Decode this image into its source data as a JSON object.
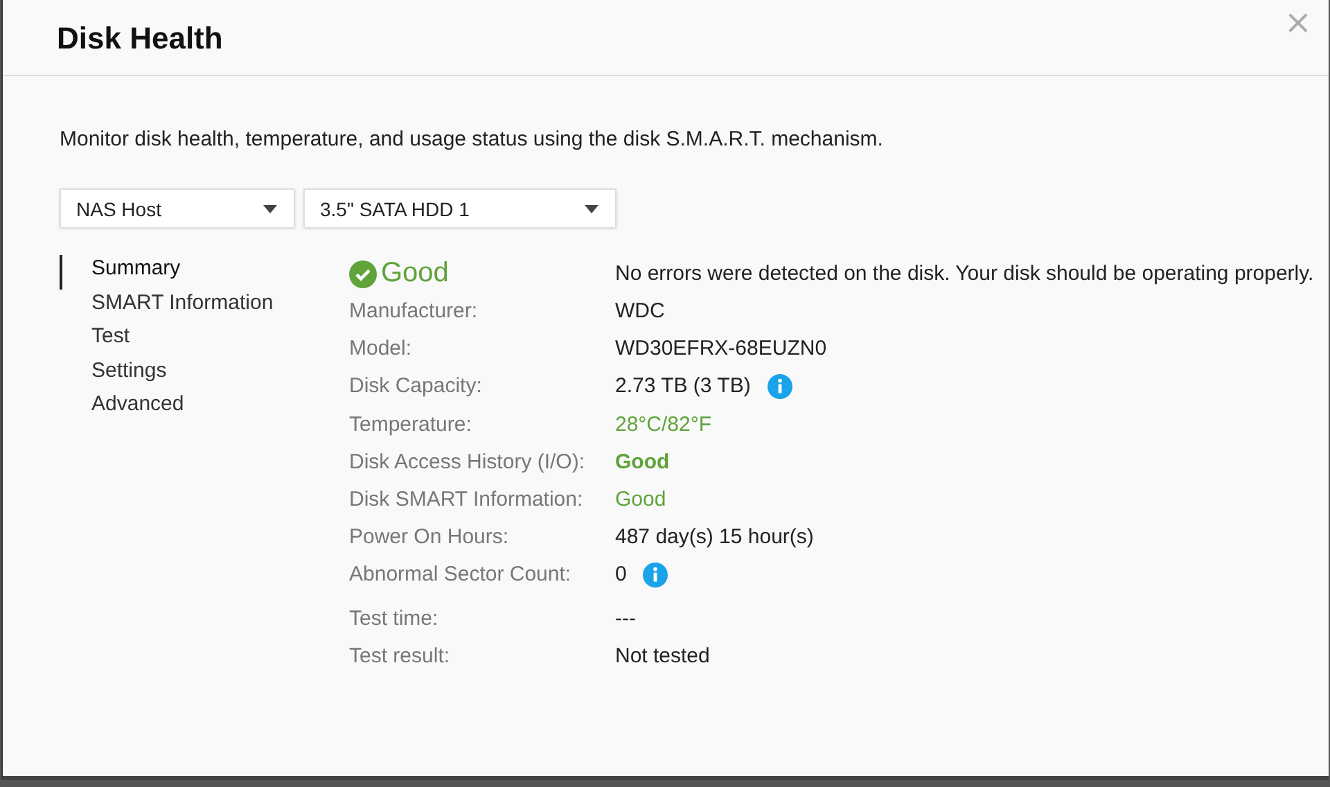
{
  "window": {
    "title": "Disk Health",
    "close": "×"
  },
  "description": "Monitor disk health, temperature, and usage status using the disk S.M.A.R.T. mechanism.",
  "selectors": [
    {
      "value": "NAS Host"
    },
    {
      "value": "3.5\" SATA HDD 1"
    }
  ],
  "sidebar": {
    "items": [
      {
        "label": "Summary",
        "selected": true
      },
      {
        "label": "SMART Information",
        "selected": false
      },
      {
        "label": "Test",
        "selected": false
      },
      {
        "label": "Settings",
        "selected": false
      },
      {
        "label": "Advanced",
        "selected": false
      }
    ]
  },
  "status": {
    "label": "Good",
    "good": true,
    "message": "No errors were detected on the disk. Your disk should be operating properly."
  },
  "details": [
    {
      "label": "Manufacturer:",
      "value": "WDC",
      "good": false,
      "bold": false,
      "info": false
    },
    {
      "label": "Model:",
      "value": "WD30EFRX-68EUZN0",
      "good": false,
      "bold": false,
      "info": false
    },
    {
      "label": "Disk Capacity:",
      "value": "2.73 TB (3 TB)",
      "good": false,
      "bold": false,
      "info": true
    },
    {
      "label": "Temperature:",
      "value": "28°C/82°F",
      "good": true,
      "bold": false,
      "info": false
    },
    {
      "label": "Disk Access History (I/O):",
      "value": "Good",
      "good": true,
      "bold": true,
      "info": false
    },
    {
      "label": "Disk SMART Information:",
      "value": "Good",
      "good": true,
      "bold": false,
      "info": false
    },
    {
      "label": "Power On Hours:",
      "value": "487 day(s) 15 hour(s)",
      "good": false,
      "bold": false,
      "info": false
    },
    {
      "label": "Abnormal Sector Count:",
      "value": "0",
      "good": false,
      "bold": false,
      "info": true
    }
  ],
  "test": [
    {
      "label": "Test time:",
      "value": "---"
    },
    {
      "label": "Test result:",
      "value": "Not tested"
    }
  ]
}
